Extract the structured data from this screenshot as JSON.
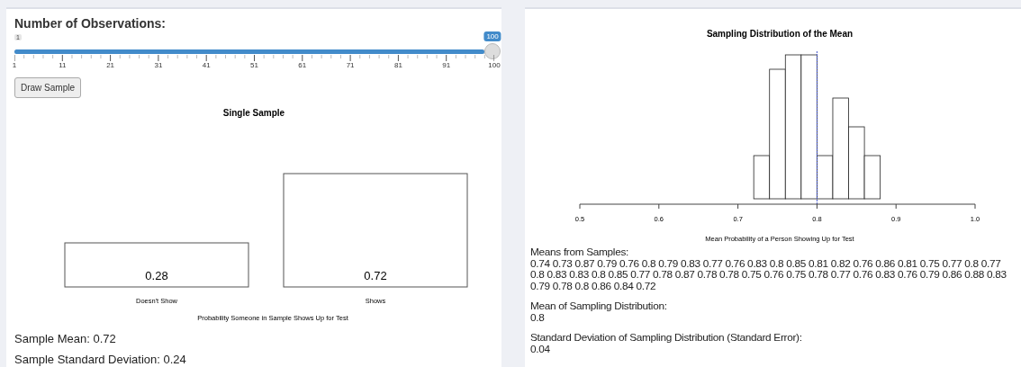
{
  "left_panel": {
    "slider": {
      "label": "Number of Observations:",
      "min_label": "1",
      "value_label": "100",
      "level": 1,
      "ticks": [
        "1",
        "11",
        "21",
        "31",
        "41",
        "51",
        "61",
        "71",
        "81",
        "91",
        "100"
      ]
    },
    "draw_button": {
      "label": "Draw Sample"
    },
    "chart_data": {
      "type": "bar",
      "title": "Single Sample",
      "xlabel": "Probability Someone in Sample Shows Up for Test",
      "categories": [
        "Doesn't Show",
        "Shows"
      ],
      "values": [
        0.28,
        0.72
      ],
      "value_labels": [
        "0.28",
        "0.72"
      ],
      "data_labels": true
    },
    "stats": [
      {
        "label": "Sample Mean:",
        "value": "0.72"
      },
      {
        "label": "Sample Standard Deviation:",
        "value": "0.24"
      }
    ]
  },
  "right_panel": {
    "chart": {
      "title": "Sampling Distribution of the Mean",
      "xlabel": "Mean Probability of a Person Showing Up for Test",
      "xticks": [
        "0.5",
        "0.6",
        "0.7",
        "0.8",
        "0.9",
        "1.0"
      ]
    },
    "outputs": [
      {
        "label": "Means from Samples:",
        "value": "0.74 0.73 0.87 0.79 0.76 0.8 0.79 0.83 0.77 0.76 0.83 0.8 0.85 0.81 0.82 0.76 0.86 0.81 0.75 0.77 0.8 0.77 0.8 0.83 0.83 0.8 0.85 0.77 0.78 0.87 0.78 0.78 0.75 0.76 0.75 0.78 0.77 0.76 0.83 0.76 0.79 0.86 0.88 0.83 0.79 0.78 0.8 0.86 0.84 0.72"
      },
      {
        "label": "Mean of Sampling Distribution:",
        "value": "0.8"
      },
      {
        "label": "Standard Deviation of Sampling Distribution (Standard Error):",
        "value": "0.04"
      }
    ]
  }
}
